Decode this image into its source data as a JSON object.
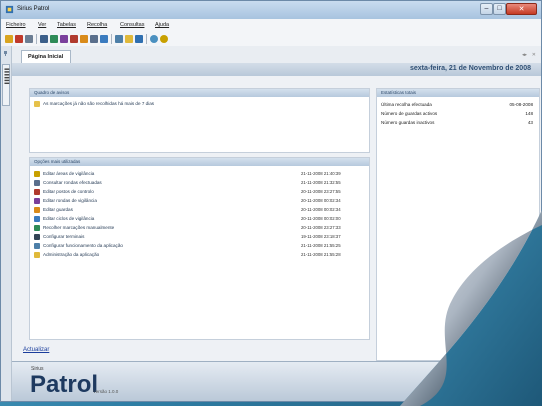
{
  "window": {
    "title": "Sirius Patrol"
  },
  "menu": [
    "Ficheiro",
    "Ver",
    "Tabelas",
    "Recolha",
    "Consultas",
    "Ajuda"
  ],
  "tab": {
    "label": "Página Inicial"
  },
  "date_banner": "sexta-feira, 21 de Novembro de 2008",
  "alerts": {
    "header": "Quadro de avisos",
    "items": [
      "As marcações já não são recolhidas há mais de 7 dias"
    ]
  },
  "recent": {
    "header": "Opções mais utilizadas",
    "items": [
      {
        "label": "Editar áreas de vigilância",
        "date": "21-11-2008 21:40:39",
        "color": "#c8a000"
      },
      {
        "label": "Consultar rondas efectuadas",
        "date": "21-11-2008 21:32:55",
        "color": "#5a6f8c"
      },
      {
        "label": "Editar postos de controlo",
        "date": "20-11-2008 23:27:55",
        "color": "#b03a2e"
      },
      {
        "label": "Editar rondas de vigilância",
        "date": "20-11-2008 00:02:34",
        "color": "#7a3f9c"
      },
      {
        "label": "Editar guardas",
        "date": "20-11-2008 00:02:34",
        "color": "#d98b1a"
      },
      {
        "label": "Editar ciclos de vigilância",
        "date": "20-11-2008 00:02:00",
        "color": "#3a7bbf"
      },
      {
        "label": "Recolher marcações manualmente",
        "date": "20-11-2008 23:27:33",
        "color": "#2e8b57"
      },
      {
        "label": "Configurar terminais",
        "date": "19-11-2008 23:18:37",
        "color": "#334455"
      },
      {
        "label": "Configurar funcionamento da aplicação",
        "date": "21-11-2008 21:55:25",
        "color": "#4d7fa8"
      },
      {
        "label": "Administração da aplicação",
        "date": "21-11-2008 21:55:28",
        "color": "#e0b93a"
      }
    ]
  },
  "stats": {
    "header": "Estatísticas totais",
    "rows": [
      {
        "label": "Última recolha efectuada",
        "value": "05-08-2008"
      },
      {
        "label": "Número de guardas activos",
        "value": "148"
      },
      {
        "label": "Número guardas inactivos",
        "value": "43"
      }
    ]
  },
  "refresh_label": "Actualizar",
  "footer": {
    "brand_small": "Sirius",
    "brand": "Patrol",
    "version": "Versão 1.0.0"
  }
}
